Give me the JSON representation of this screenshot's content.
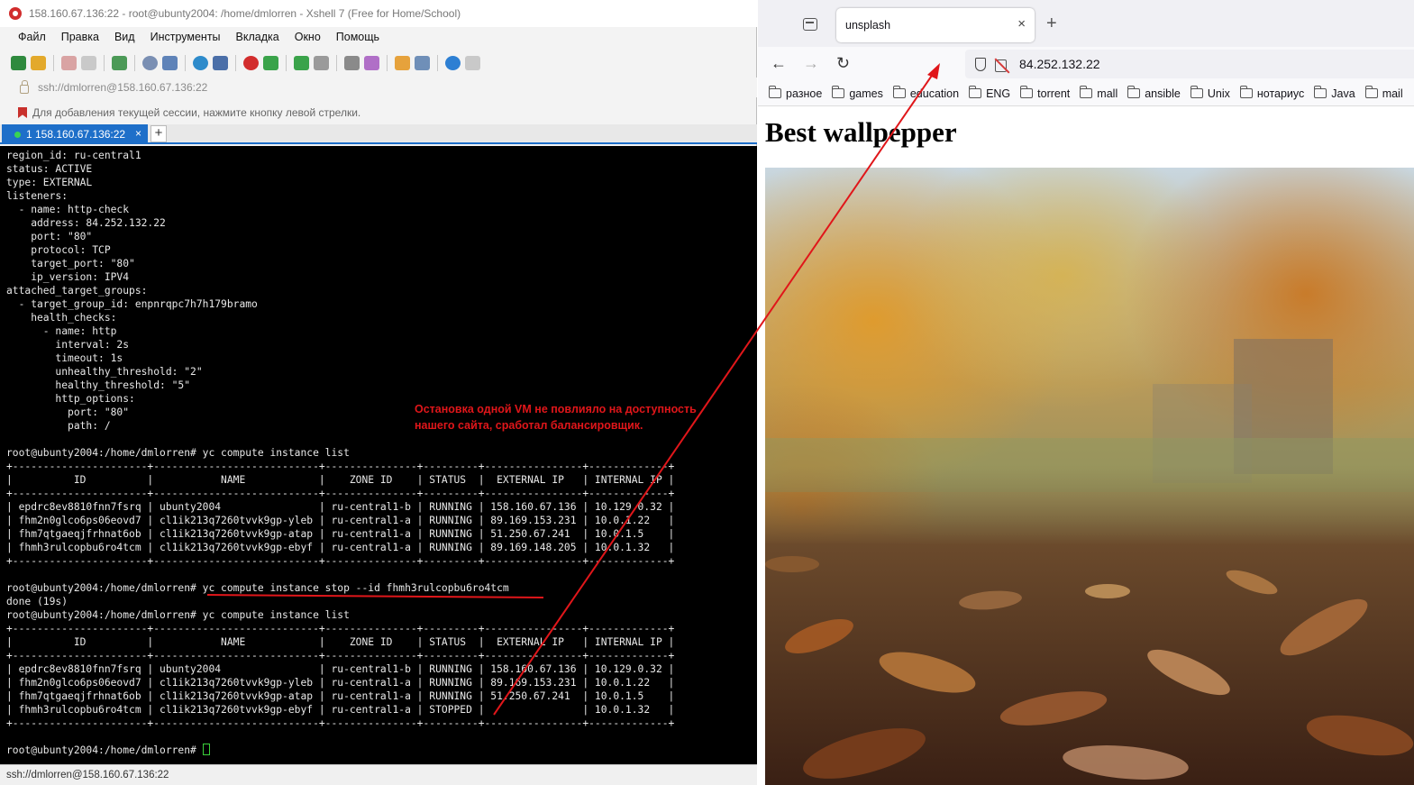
{
  "xshell": {
    "title": "158.160.67.136:22 - root@ubunty2004: /home/dmlorren - Xshell 7 (Free for Home/School)",
    "menu": [
      "Файл",
      "Правка",
      "Вид",
      "Инструменты",
      "Вкладка",
      "Окно",
      "Помощь"
    ],
    "address": "ssh://dmlorren@158.160.67.136:22",
    "hint": "Для добавления текущей сессии, нажмите кнопку левой стрелки.",
    "tab_label": "1 158.160.67.136:22",
    "tab_close": "×",
    "new_tab": "+",
    "status": "ssh://dmlorren@158.160.67.136:22",
    "annotation": [
      "Остановка одной VM не повлияло на доступность",
      "нашего сайта, сработал балансировщик."
    ],
    "terminal_lines": [
      "region_id: ru-central1",
      "status: ACTIVE",
      "type: EXTERNAL",
      "listeners:",
      "  - name: http-check",
      "    address: 84.252.132.22",
      "    port: \"80\"",
      "    protocol: TCP",
      "    target_port: \"80\"",
      "    ip_version: IPV4",
      "attached_target_groups:",
      "  - target_group_id: enpnrqpc7h7h179bramo",
      "    health_checks:",
      "      - name: http",
      "        interval: 2s",
      "        timeout: 1s",
      "        unhealthy_threshold: \"2\"",
      "        healthy_threshold: \"5\"",
      "        http_options:",
      "          port: \"80\"",
      "          path: /",
      "",
      "root@ubunty2004:/home/dmlorren# yc compute instance list",
      "+----------------------+---------------------------+---------------+---------+----------------+-------------+",
      "|          ID          |           NAME            |    ZONE ID    | STATUS  |  EXTERNAL IP   | INTERNAL IP |",
      "+----------------------+---------------------------+---------------+---------+----------------+-------------+",
      "| epdrc8ev8810fnn7fsrq | ubunty2004                | ru-central1-b | RUNNING | 158.160.67.136 | 10.129.0.32 |",
      "| fhm2n0glco6ps06eovd7 | cl1ik213q7260tvvk9gp-yleb | ru-central1-a | RUNNING | 89.169.153.231 | 10.0.1.22   |",
      "| fhm7qtgaeqjfrhnat6ob | cl1ik213q7260tvvk9gp-atap | ru-central1-a | RUNNING | 51.250.67.241  | 10.0.1.5    |",
      "| fhmh3rulcopbu6ro4tcm | cl1ik213q7260tvvk9gp-ebyf | ru-central1-a | RUNNING | 89.169.148.205 | 10.0.1.32   |",
      "+----------------------+---------------------------+---------------+---------+----------------+-------------+",
      "",
      "root@ubunty2004:/home/dmlorren# yc compute instance stop --id fhmh3rulcopbu6ro4tcm",
      "done (19s)",
      "root@ubunty2004:/home/dmlorren# yc compute instance list",
      "+----------------------+---------------------------+---------------+---------+----------------+-------------+",
      "|          ID          |           NAME            |    ZONE ID    | STATUS  |  EXTERNAL IP   | INTERNAL IP |",
      "+----------------------+---------------------------+---------------+---------+----------------+-------------+",
      "| epdrc8ev8810fnn7fsrq | ubunty2004                | ru-central1-b | RUNNING | 158.160.67.136 | 10.129.0.32 |",
      "| fhm2n0glco6ps06eovd7 | cl1ik213q7260tvvk9gp-yleb | ru-central1-a | RUNNING | 89.169.153.231 | 10.0.1.22   |",
      "| fhm7qtgaeqjfrhnat6ob | cl1ik213q7260tvvk9gp-atap | ru-central1-a | RUNNING | 51.250.67.241  | 10.0.1.5    |",
      "| fhmh3rulcopbu6ro4tcm | cl1ik213q7260tvvk9gp-ebyf | ru-central1-a | STOPPED |                | 10.0.1.32   |",
      "+----------------------+---------------------------+---------------+---------+----------------+-------------+",
      "",
      "root@ubunty2004:/home/dmlorren# "
    ]
  },
  "browser": {
    "tab_title": "unsplash",
    "tab_close": "×",
    "new_tab": "+",
    "back": "←",
    "forward": "→",
    "reload": "↻",
    "url": "84.252.132.22",
    "bookmarks": [
      "разное",
      "games",
      "education",
      "ENG",
      "torrent",
      "mall",
      "ansible",
      "Unix",
      "нотариус",
      "Java",
      "mail"
    ],
    "page_heading": "Best wallpepper"
  },
  "colors": {
    "annotation_red": "#e0161a",
    "xshell_tab_blue": "#1e6fc9",
    "terminal_bg": "#000000"
  }
}
